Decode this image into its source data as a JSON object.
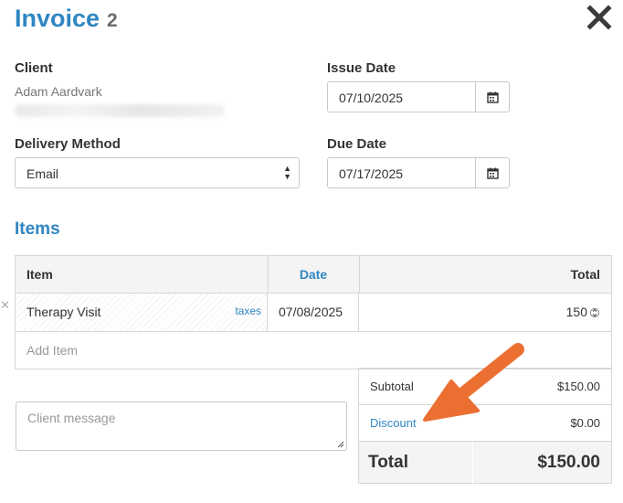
{
  "header": {
    "title": "Invoice",
    "number": "2"
  },
  "client": {
    "label": "Client",
    "name": "Adam Aardvark"
  },
  "issue_date": {
    "label": "Issue Date",
    "value": "07/10/2025"
  },
  "delivery": {
    "label": "Delivery Method",
    "selected": "Email"
  },
  "due_date": {
    "label": "Due Date",
    "value": "07/17/2025"
  },
  "items": {
    "title": "Items",
    "columns": {
      "item": "Item",
      "date": "Date",
      "total": "Total"
    },
    "rows": [
      {
        "item": "Therapy Visit",
        "taxes": "taxes",
        "date": "07/08/2025",
        "total": "150"
      }
    ],
    "add_item_placeholder": "Add Item"
  },
  "client_message": {
    "placeholder": "Client message"
  },
  "summary": {
    "subtotal_label": "Subtotal",
    "subtotal_value": "$150.00",
    "discount_label": "Discount",
    "discount_value": "$0.00",
    "total_label": "Total",
    "total_value": "$150.00"
  },
  "colors": {
    "accent": "#2f86c2",
    "annotation_arrow": "#ec6f32"
  }
}
